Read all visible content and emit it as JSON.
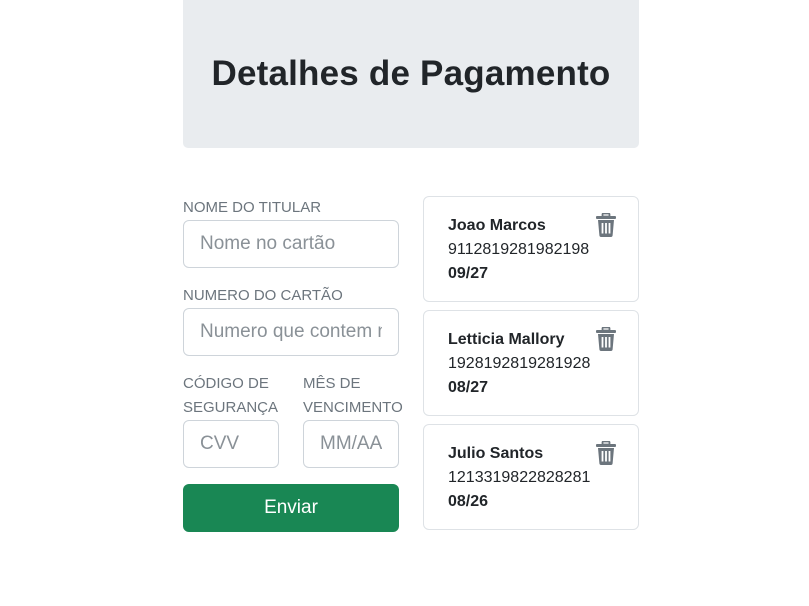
{
  "header": {
    "title": "Detalhes de Pagamento"
  },
  "form": {
    "holder_label": "NOME DO TITULAR",
    "holder_placeholder": "Nome no cartão",
    "number_label": "NUMERO DO CARTÃO",
    "number_placeholder": "Numero que contem na frente do cartão",
    "cvv_label": "CÓDIGO DE SEGURANÇA",
    "cvv_placeholder": "CVV",
    "expiry_label": "MÊS DE VENCIMENTO",
    "expiry_placeholder": "MM/AA",
    "submit_label": "Enviar"
  },
  "cards": [
    {
      "name": "Joao Marcos",
      "number": "9112819281982198",
      "expiry": "09/27",
      "icon": "trash-icon"
    },
    {
      "name": "Letticia Mallory",
      "number": "1928192819281928",
      "expiry": "08/27",
      "icon": "trash-icon"
    },
    {
      "name": "Julio Santos",
      "number": "1213319822828281",
      "expiry": "08/26",
      "icon": "trash-icon"
    }
  ],
  "colors": {
    "header_bg": "#e9ecef",
    "submit_bg": "#198754",
    "icon": "#6c757d"
  }
}
